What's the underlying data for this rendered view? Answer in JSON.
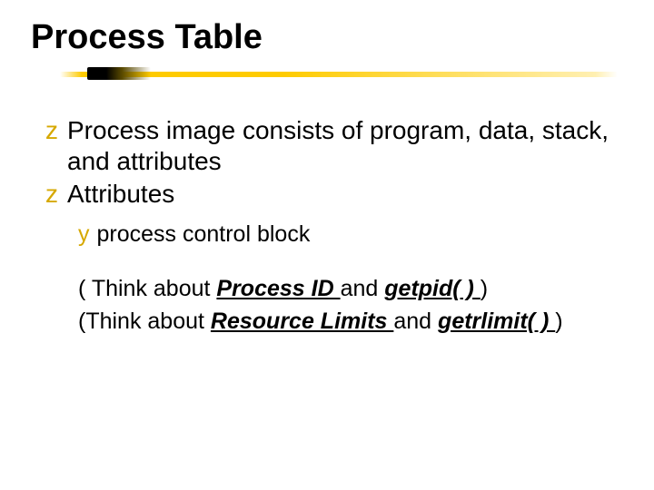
{
  "title": "Process Table",
  "bullets": [
    {
      "text": "Process image consists of program, data, stack, and attributes"
    },
    {
      "text": "Attributes"
    }
  ],
  "sub_bullet": "process control block",
  "think1": {
    "pre": "( Think about ",
    "em1": "Process ID ",
    "mid": "and ",
    "em2": "getpid( ) ",
    "post": ")"
  },
  "think2": {
    "pre": "(Think about ",
    "em1": "Resource Limits ",
    "mid": "and ",
    "em2": "getrlimit( ) ",
    "post": ")"
  }
}
